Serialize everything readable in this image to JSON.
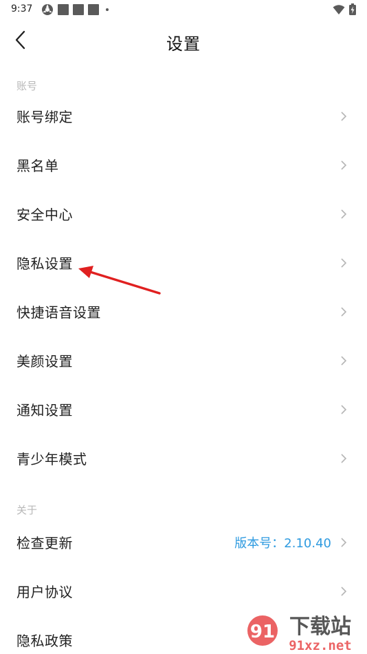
{
  "status_bar": {
    "time": "9:37",
    "icons_left": [
      "vpn-icon",
      "notification-square-icon",
      "notification-square-icon",
      "notification-square-icon",
      "more-dot-icon"
    ],
    "icons_right": [
      "wifi-icon",
      "battery-charging-icon"
    ]
  },
  "header": {
    "title": "设置",
    "back_icon": "chevron-left-icon"
  },
  "sections": {
    "account_label": "账号",
    "about_label": "关于"
  },
  "rows": {
    "account_binding": "账号绑定",
    "blacklist": "黑名单",
    "security_center": "安全中心",
    "privacy_settings": "隐私设置",
    "quick_voice": "快捷语音设置",
    "beauty": "美颜设置",
    "notifications": "通知设置",
    "teen_mode": "青少年模式",
    "check_update": "检查更新",
    "version_value": "版本号：2.10.40",
    "user_agreement": "用户协议",
    "privacy_policy": "隐私政策"
  },
  "colors": {
    "accent_blue": "#2f9be0",
    "annotation_red": "#e02020",
    "section_gray": "#b8b8b8"
  },
  "watermark": {
    "brand": "下载站",
    "domain": "91xz.net",
    "logo_text": "91"
  }
}
